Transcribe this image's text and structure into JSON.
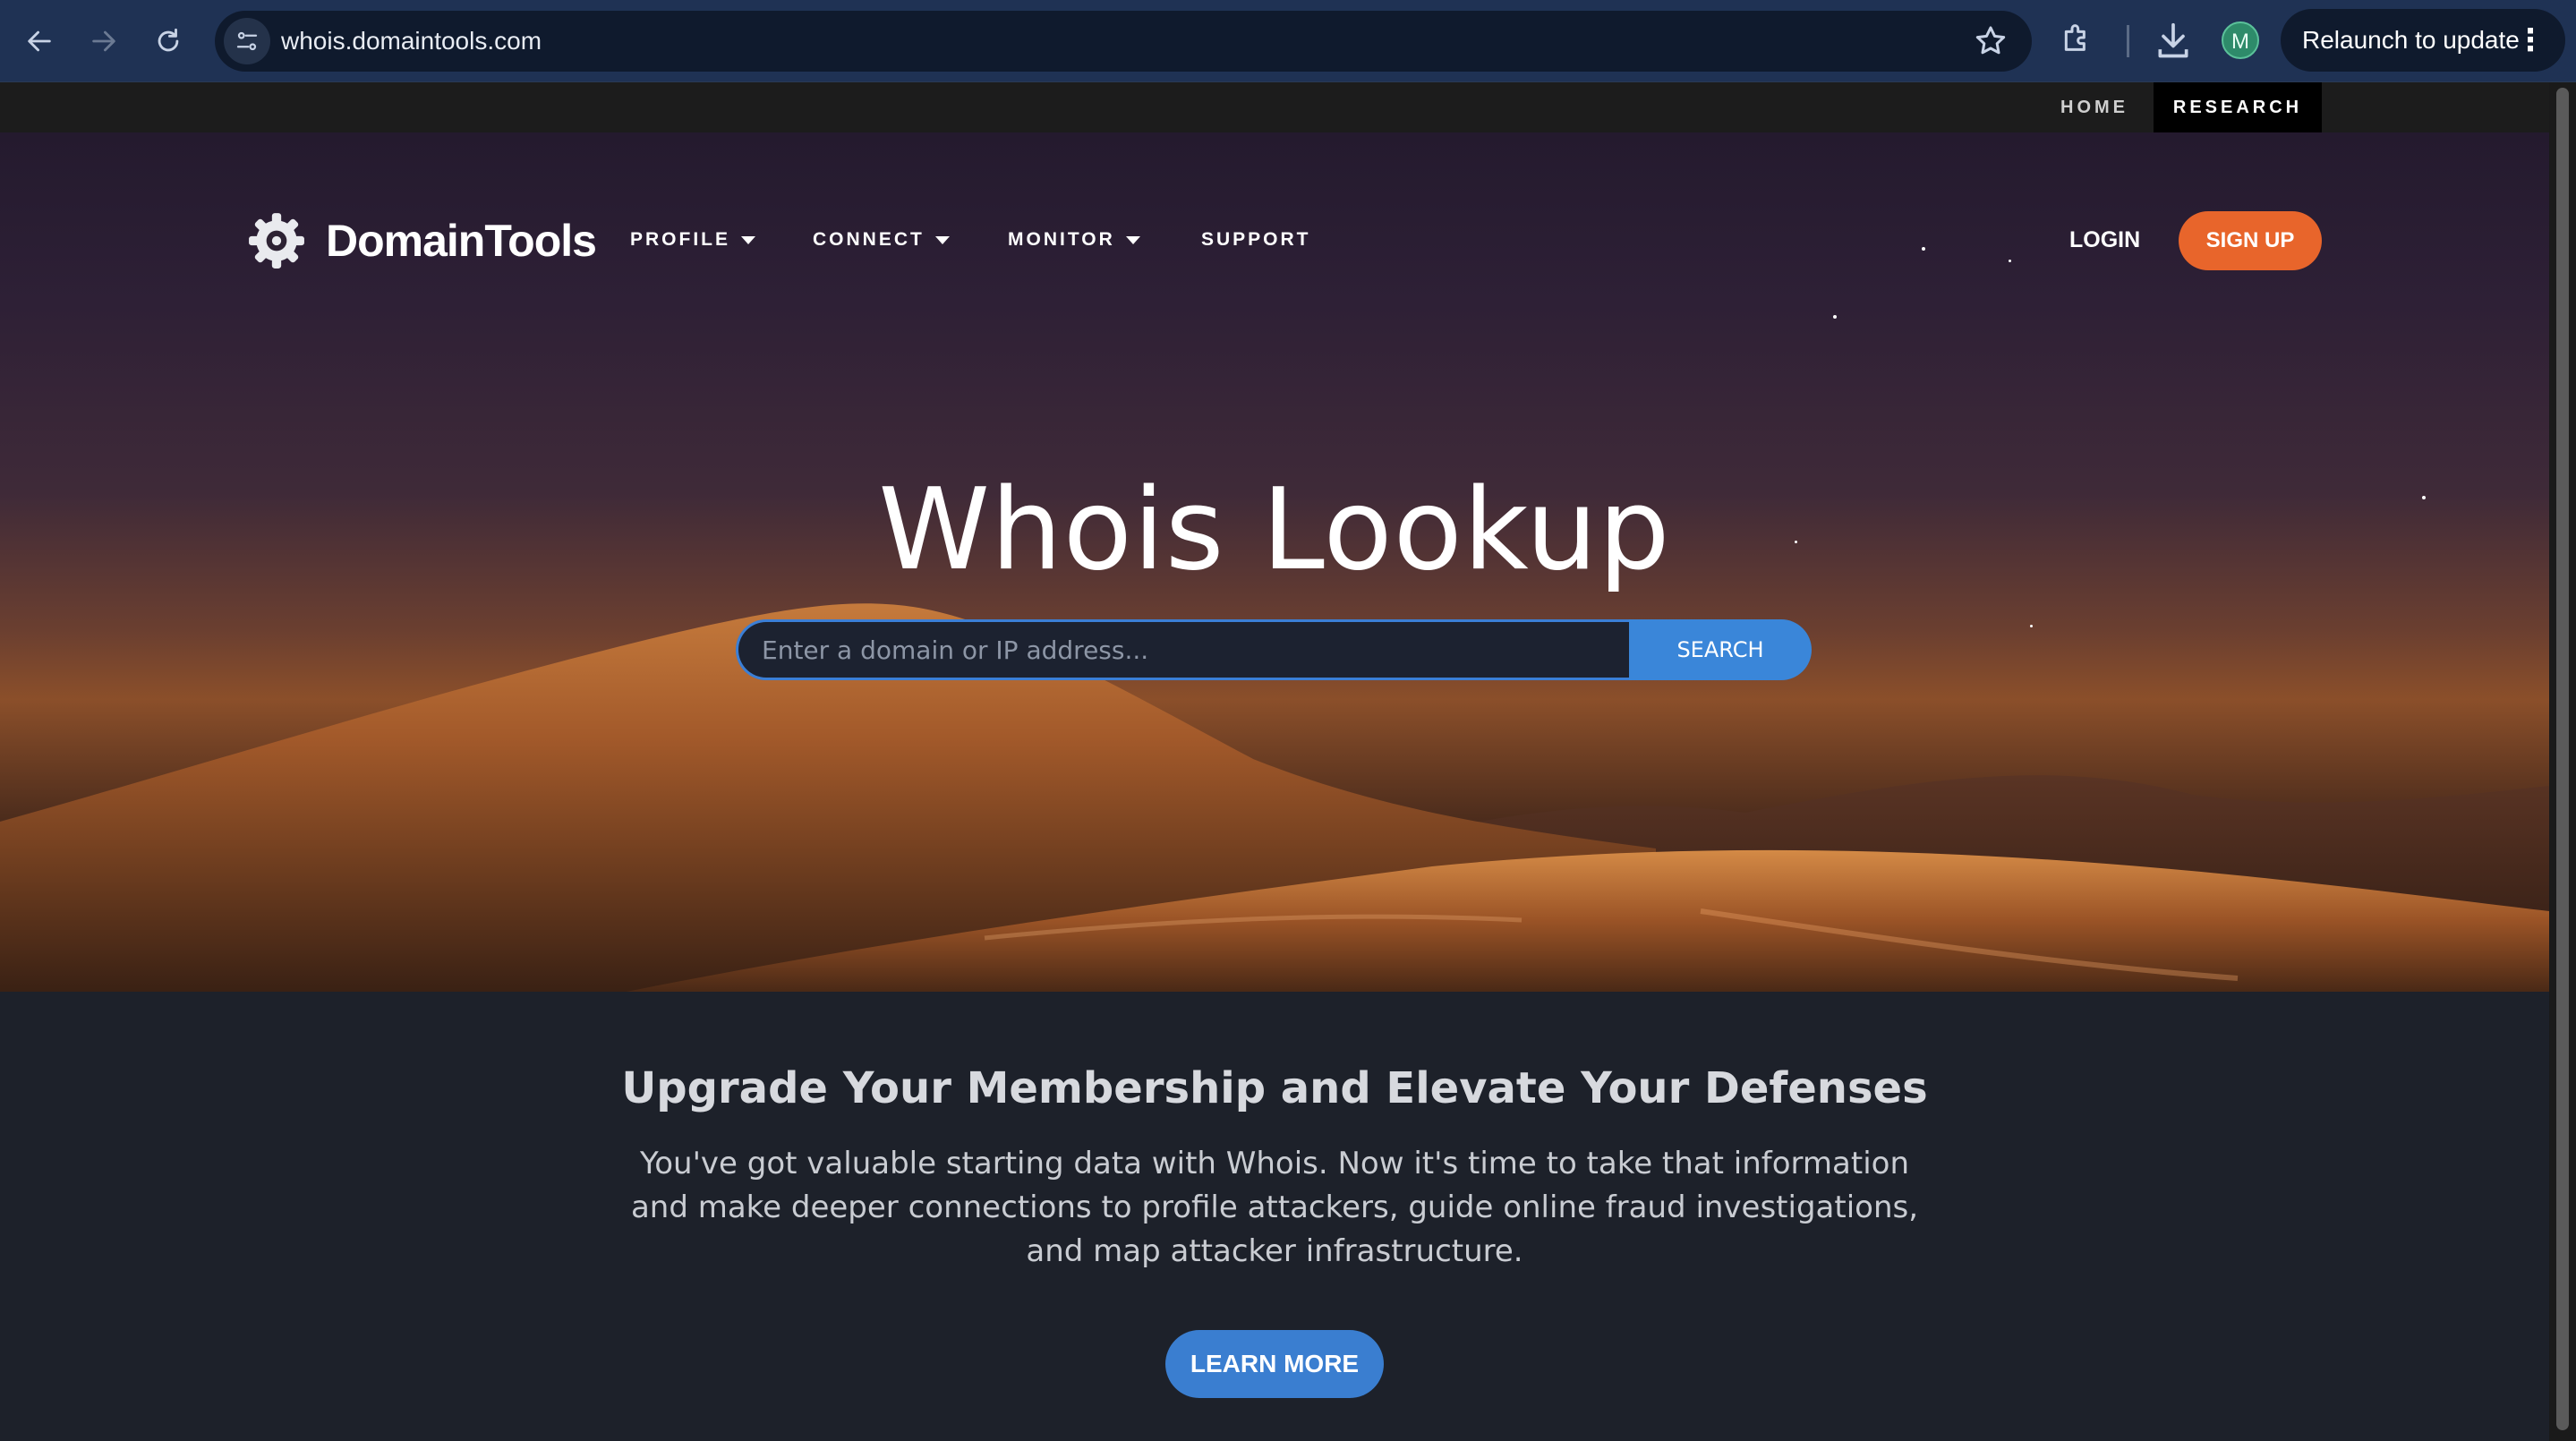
{
  "browser": {
    "url": "whois.domaintools.com",
    "profile_initial": "M",
    "relaunch_label": "Relaunch to update",
    "icons": [
      "back-icon",
      "forward-icon",
      "reload-icon",
      "site-info-icon",
      "bookmark-star-icon",
      "extensions-icon",
      "download-icon",
      "more-vert-icon"
    ]
  },
  "topbar": {
    "home": "HOME",
    "research": "RESEARCH"
  },
  "header": {
    "logo_text": "DomainTools",
    "nav": {
      "profile": "PROFILE",
      "connect": "CONNECT",
      "monitor": "MONITOR",
      "support": "SUPPORT"
    },
    "login": "LOGIN",
    "signup": "SIGN UP"
  },
  "hero": {
    "title": "Whois Lookup",
    "search_placeholder": "Enter a domain or IP address...",
    "search_button": "SEARCH"
  },
  "promo": {
    "title": "Upgrade Your Membership and Elevate Your Defenses",
    "body": "You've got valuable starting data with Whois. Now it's time to take that information and make deeper connections to profile attackers, guide online fraud investigations, and map attacker infrastructure.",
    "button": "LEARN MORE"
  },
  "colors": {
    "brand_orange": "#e8652b",
    "search_blue": "#3a86d9",
    "learn_more_blue": "#3a7ed0",
    "page_dark": "#1d212a"
  }
}
